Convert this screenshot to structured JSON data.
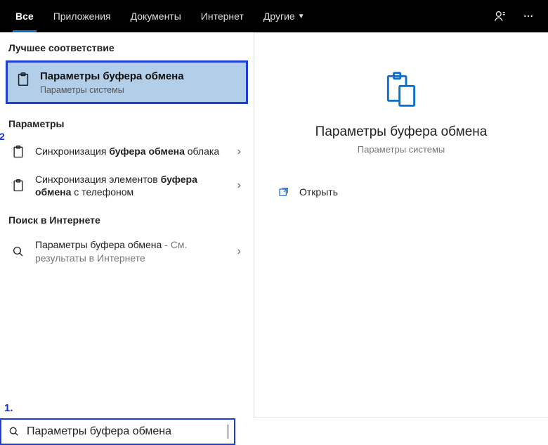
{
  "top_tabs": {
    "all": "Все",
    "apps": "Приложения",
    "docs": "Документы",
    "internet": "Интернет",
    "more": "Другие"
  },
  "sections": {
    "best_match": "Лучшее соответствие",
    "settings": "Параметры",
    "web_search": "Поиск в Интернете"
  },
  "best_match_item": {
    "title": "Параметры буфера обмена",
    "subtitle": "Параметры системы"
  },
  "results": {
    "sync_cloud_prefix": "Синхронизация ",
    "sync_cloud_bold": "буфера обмена",
    "sync_cloud_suffix": " облака",
    "sync_phone_prefix": "Синхронизация элементов ",
    "sync_phone_bold1": "буфера обмена",
    "sync_phone_mid": " с телефоном",
    "web_prefix": "Параметры буфера обмена",
    "web_suffix": " - См. результаты в Интернете"
  },
  "preview": {
    "title": "Параметры буфера обмена",
    "subtitle": "Параметры системы",
    "open_label": "Открыть"
  },
  "search": {
    "value": "Параметры буфера обмена"
  },
  "annotations": {
    "one": "1.",
    "two": "2"
  }
}
